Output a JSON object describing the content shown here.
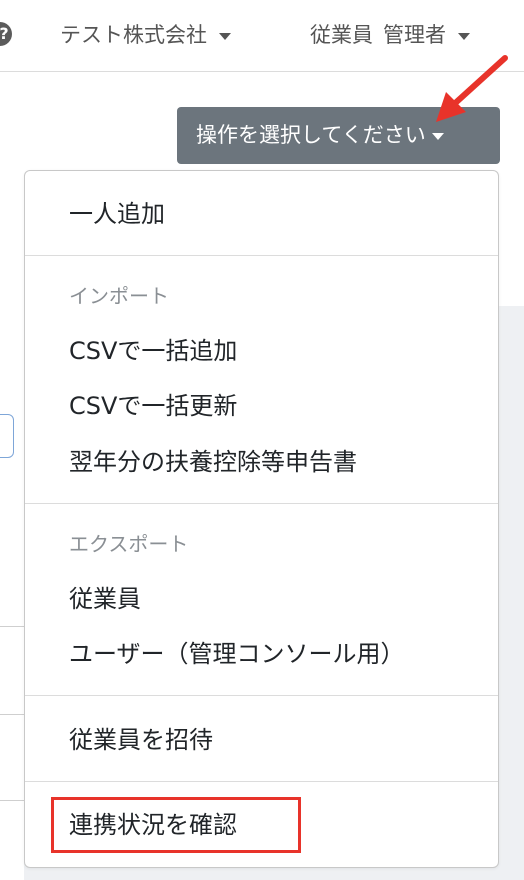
{
  "navbar": {
    "help_icon": "question-circle-icon",
    "help_glyph": "?",
    "company_label": "テスト株式会社",
    "user_name": "従業員",
    "user_role": "管理者"
  },
  "action_button": {
    "label": "操作を選択してください"
  },
  "dropdown": {
    "item_add_one": "一人追加",
    "import_header": "インポート",
    "import_items": [
      "CSVで一括追加",
      "CSVで一括更新",
      "翌年分の扶養控除等申告書"
    ],
    "export_header": "エクスポート",
    "export_items": [
      "従業員",
      "ユーザー（管理コンソール用）"
    ],
    "invite": "従業員を招待",
    "check_integration": "連携状況を確認"
  },
  "colors": {
    "button_bg": "#6c757d",
    "annotation_red": "#e8332a",
    "header_gray": "#8a8f94"
  }
}
